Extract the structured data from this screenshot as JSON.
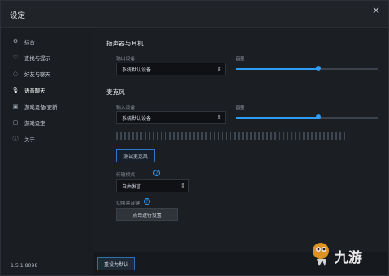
{
  "window": {
    "title": "设定",
    "close_glyph": "✕"
  },
  "sidebar": {
    "items": [
      {
        "label": "综合",
        "icon": "sliders-icon",
        "active": false
      },
      {
        "label": "查找与提示",
        "icon": "bell-icon",
        "active": false
      },
      {
        "label": "好友与聊天",
        "icon": "chat-icon",
        "active": false
      },
      {
        "label": "语音聊天",
        "icon": "microphone-icon",
        "active": true
      },
      {
        "label": "游戏设备/更新",
        "icon": "device-icon",
        "active": false
      },
      {
        "label": "游戏设定",
        "icon": "gamepad-icon",
        "active": false
      },
      {
        "label": "关于",
        "icon": "info-icon",
        "active": false
      }
    ],
    "version": "1.5.1.8098"
  },
  "speaker_section": {
    "title": "扬声器与耳机",
    "output_label": "输出设备",
    "output_value": "系统默认设备",
    "volume_label": "音量",
    "volume_level": 0.58
  },
  "mic_section": {
    "title": "麦克风",
    "input_label": "输入设备",
    "input_value": "系统默认设备",
    "volume_label": "音量",
    "volume_level": 0.58,
    "test_button": "测试麦克风",
    "mode_label": "传输模式",
    "mode_value": "自由发言",
    "shortcut_label": "切换禁音键",
    "shortcut_button": "点击进行设置"
  },
  "footer": {
    "reset_label": "重设为默认"
  },
  "watermark": {
    "brand_text": "九游"
  },
  "colors": {
    "accent": "#2d9cf3",
    "background": "#1b1e22",
    "sidebar_bg": "#1a1d21"
  }
}
